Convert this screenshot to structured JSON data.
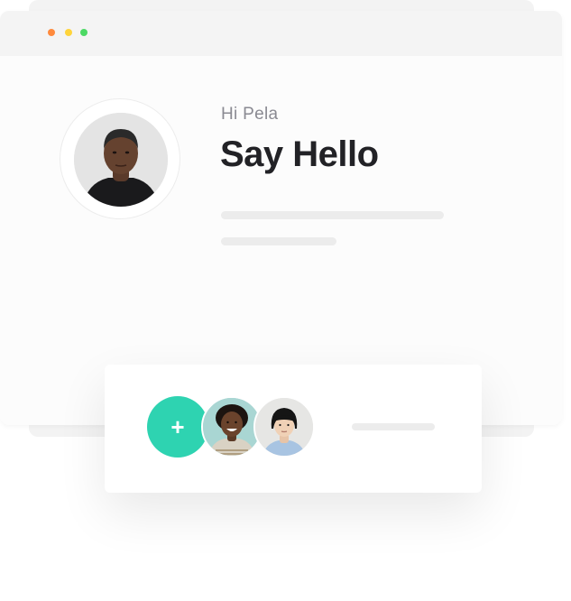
{
  "window": {
    "controls": {
      "close_color": "#ff8a3d",
      "minimize_color": "#ffd43b",
      "maximize_color": "#4cd964"
    }
  },
  "profile": {
    "greeting": "Hi Pela",
    "headline": "Say Hello",
    "avatar": "woman-portrait"
  },
  "group_card": {
    "add_button_label": "+",
    "accent_color": "#2ed3b1",
    "members": [
      {
        "avatar": "woman-curly-hair-portrait"
      },
      {
        "avatar": "person-bob-haircut-portrait"
      }
    ]
  },
  "icons": {
    "add": "plus-icon"
  }
}
